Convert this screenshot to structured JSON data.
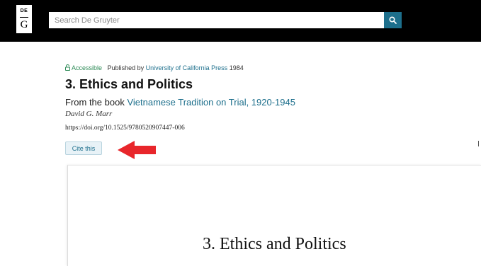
{
  "header": {
    "logo_top": "DE",
    "logo_bottom": "G",
    "search_placeholder": "Search De Gruyter",
    "search_button_icon": "search-icon"
  },
  "article": {
    "access_label": "Accessible",
    "access_icon": "lock-open-icon",
    "published_by_label": "Published by",
    "publisher": "University of California Press",
    "year": "1984",
    "title": "3. Ethics and Politics",
    "from_book_label": "From the book",
    "book_title": "Vietnamese Tradition on Trial, 1920-1945",
    "author": "David G. Marr",
    "doi": "https://doi.org/10.1525/9780520907447-006",
    "cite_label": "Cite this"
  },
  "annotation": {
    "arrow_color": "#e8262b"
  },
  "preview": {
    "page_heading": "3. Ethics and Politics"
  },
  "colors": {
    "header_bg": "#000000",
    "accent": "#1d6f8c",
    "accessible": "#2e8b57"
  }
}
